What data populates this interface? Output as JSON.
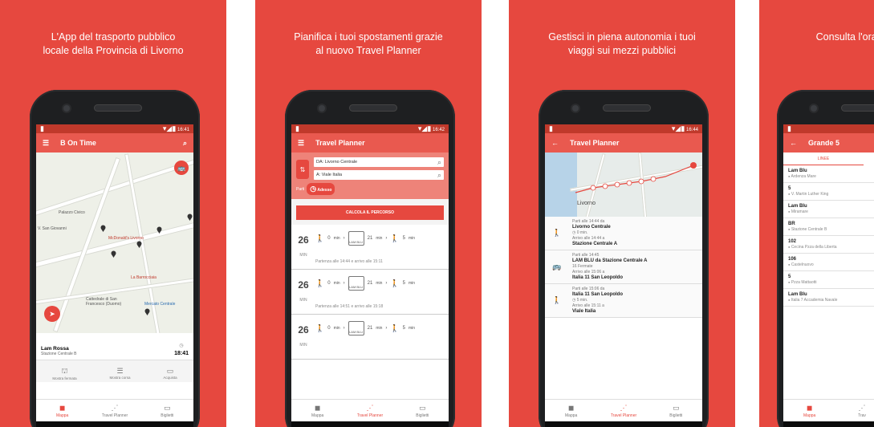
{
  "panels": [
    {
      "caption": "L'App del trasporto pubblico locale della Provincia di Livorno",
      "status_time": "16:41",
      "title": "B On Time",
      "map_labels": [
        "Palazzo Civico",
        "McDonald's Livorno",
        "La Barrocciaia",
        "Cattedrale di San Francesco (Duomo)",
        "Mercato Centrale",
        "V. San Giovanni"
      ],
      "bottom_sheet": {
        "line": "Lam Rossa",
        "stop": "Stazione Centrale B",
        "time": "18:41"
      },
      "actions": [
        "Mostra fermata",
        "Mostra corsa",
        "Acquista"
      ],
      "nav": [
        "Mappa",
        "Travel Planner",
        "Biglietti"
      ],
      "active_nav": 0
    },
    {
      "caption": "Pianifica i tuoi spostamenti grazie al nuovo Travel Planner",
      "status_time": "16:42",
      "title": "Travel Planner",
      "from": "DA: Livorno Centrale",
      "to": "A: Viale Italia",
      "depart_label": "Parti",
      "depart_value": "Adesso",
      "calc": "CALCOLA IL PERCORSO",
      "routes": [
        {
          "min": "26",
          "unit": "MIN",
          "walk1": "0",
          "bus_min": "21",
          "walk2": "5",
          "line": "LAM BLU",
          "times": "Partenza alle 14:44 e arrivo alle 15:11"
        },
        {
          "min": "26",
          "unit": "MIN",
          "walk1": "0",
          "bus_min": "21",
          "walk2": "5",
          "line": "LAM BLU",
          "times": "Partenza alle 14:51 e arrivo alle 15:18"
        },
        {
          "min": "26",
          "unit": "MIN",
          "walk1": "0",
          "bus_min": "21",
          "walk2": "5",
          "line": "LAM BLU",
          "times": ""
        }
      ],
      "min_label": "min",
      "nav": [
        "Mappa",
        "Travel Planner",
        "Biglietti"
      ],
      "active_nav": 1
    },
    {
      "caption": "Gestisci in piena autonomia i tuoi viaggi sui mezzi pubblici",
      "status_time": "16:44",
      "title": "Travel Planner",
      "map_label": "Livorno",
      "steps": [
        {
          "l1": "Parti alle 14:44 da",
          "b1": "Livorno Centrale",
          "l2": "0 min.",
          "l3": "Arrivo alle 14:44 a",
          "b2": "Stazione Centrale A"
        },
        {
          "l1": "Parti alle 14:45",
          "b1": "LAM BLU da Stazione Centrale A",
          "l2": "16 Fermate",
          "l3": "Arrivo alle 15:06 a",
          "b2": "Italia 11 San Leopoldo"
        },
        {
          "l1": "Parti alle 15:06 da",
          "b1": "Italia 11 San Leopoldo",
          "l2": "5 min.",
          "l3": "Arrivo alle 15:11 a",
          "b2": "Viale Italia"
        }
      ],
      "nav": [
        "Mappa",
        "Travel Planner",
        "Biglietti"
      ],
      "active_nav": 1
    },
    {
      "caption": "Consulta l'orar piano d",
      "title": "Grande 5",
      "tab": "LINEE",
      "lines": [
        {
          "name": "Lam Blu",
          "stop": "Ardenza Mare"
        },
        {
          "name": "5",
          "stop": "V. Martin Luther King"
        },
        {
          "name": "Lam Blu",
          "stop": "Miramare"
        },
        {
          "name": "BR",
          "stop": "Stazione Centrale B"
        },
        {
          "name": "102",
          "stop": "Cecina Pzza della Liberta"
        },
        {
          "name": "106",
          "stop": "Castelnuovo"
        },
        {
          "name": "5",
          "stop": "Pzza Mattaotti"
        },
        {
          "name": "Lam Blu",
          "stop": "Italia 7 Accademia Navale"
        }
      ],
      "nav": [
        "Mappa",
        "Trav"
      ],
      "active_nav": 0
    }
  ]
}
